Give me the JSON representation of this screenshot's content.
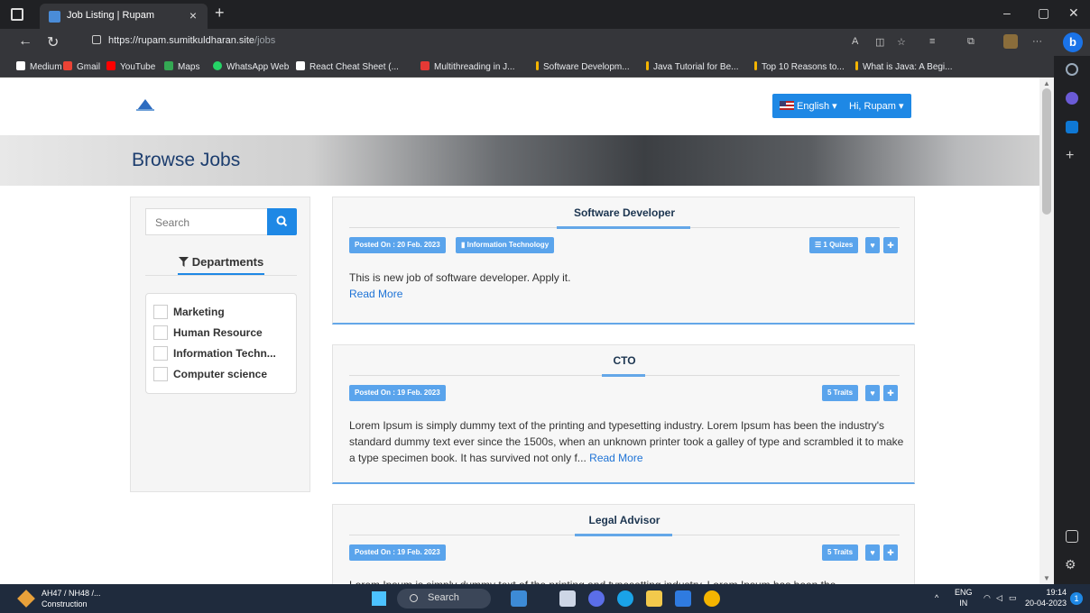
{
  "browser": {
    "tab_title": "Job Listing | Rupam",
    "tab_close": "×",
    "new_tab": "+",
    "url_host": "https://rupam.sumitkuldharan.site",
    "url_path": "/jobs",
    "window_controls": {
      "minimize": "–",
      "restore": "▢",
      "close": "✕"
    },
    "menu": "···"
  },
  "bookmarks": [
    {
      "label": "Medium",
      "color": "#ffffff"
    },
    {
      "label": "Gmail",
      "color": "#ea4335"
    },
    {
      "label": "YouTube",
      "color": "#ff0000"
    },
    {
      "label": "Maps",
      "color": "#34a853"
    },
    {
      "label": "WhatsApp Web",
      "color": "#25d366"
    },
    {
      "label": "React Cheat Sheet (...",
      "color": "#ffffff"
    },
    {
      "label": "Multithreading in J...",
      "color": "#e53935"
    },
    {
      "label": "Software Developm...",
      "color": "#f4b400"
    },
    {
      "label": "Java Tutorial for Be...",
      "color": "#f4b400"
    },
    {
      "label": "Top 10 Reasons to...",
      "color": "#f4b400"
    },
    {
      "label": "What is Java: A Begi...",
      "color": "#f4b400"
    }
  ],
  "header": {
    "language_label": "English ▾",
    "user_label": "Hi, Rupam ▾"
  },
  "hero": {
    "title": "Browse Jobs"
  },
  "filters": {
    "search_placeholder": "Search",
    "departments_heading": "Departments",
    "departments": [
      "Marketing",
      "Human Resource",
      "Information Techn...",
      "Computer science"
    ]
  },
  "jobs": [
    {
      "title": "Software Developer",
      "posted": "Posted On : 20 Feb. 2023",
      "category": "Information Technology",
      "badge": "1 Quizes",
      "description": "This is new job of software developer. Apply it.",
      "read_more": "Read More"
    },
    {
      "title": "CTO",
      "posted": "Posted On : 19 Feb. 2023",
      "badge": "5 Traits",
      "description": "Lorem Ipsum is simply dummy text of the printing and typesetting industry. Lorem Ipsum has been the industry's standard dummy text ever since the 1500s, when an unknown printer took a galley of type and scrambled it to make a type specimen book. It has survived not only f...",
      "read_more": "Read More"
    },
    {
      "title": "Legal Advisor",
      "posted": "Posted On : 19 Feb. 2023",
      "badge": "5 Traits",
      "description": "Lorem Ipsum is simply dummy text of the printing and typesetting industry. Lorem Ipsum has been the"
    }
  ],
  "taskbar": {
    "weather_line1": "AH47 / NH48 /...",
    "weather_line2": "Construction",
    "search_label": "Search",
    "lang_line1": "ENG",
    "lang_line2": "IN",
    "time": "19:14",
    "date": "20-04-2023",
    "notifications": "1"
  }
}
